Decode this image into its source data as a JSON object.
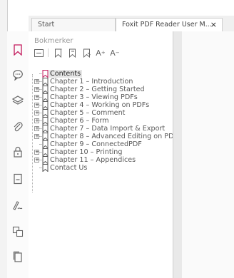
{
  "tabs": [
    {
      "label": "Start"
    },
    {
      "label": "Foxit PDF Reader User M...",
      "close": "×"
    }
  ],
  "panel": {
    "title": "Bokmerker",
    "toolbar": {
      "font_up": "A",
      "font_down": "A"
    }
  },
  "bookmarks": [
    {
      "label": "Contents",
      "expandable": false,
      "selected": true
    },
    {
      "label": "Chapter 1 – Introduction",
      "expandable": true
    },
    {
      "label": "Chapter 2 – Getting Started",
      "expandable": true
    },
    {
      "label": "Chapter 3 – Viewing PDFs",
      "expandable": true
    },
    {
      "label": "Chapter 4 – Working on PDFs",
      "expandable": true
    },
    {
      "label": "Chapter 5 – Comment",
      "expandable": true
    },
    {
      "label": "Chapter 6 – Form",
      "expandable": true
    },
    {
      "label": "Chapter 7 – Data Import & Export",
      "expandable": true
    },
    {
      "label": "Chapter 8 – Advanced Editing on PD",
      "expandable": true
    },
    {
      "label": "Chapter 9 – ConnectedPDF",
      "expandable": false
    },
    {
      "label": "Chapter 10 – Printing",
      "expandable": true
    },
    {
      "label": "Chapter 11 – Appendices",
      "expandable": true
    },
    {
      "label": "Contact Us",
      "expandable": false
    }
  ],
  "colors": {
    "accent": "#c2185b",
    "bookmark_active": "#c2185b",
    "bookmark": "#555555"
  },
  "sidebar_icons": [
    "bookmark-icon",
    "comment-icon",
    "layers-icon",
    "attachment-icon",
    "lock-icon",
    "page-icon",
    "signature-icon",
    "content-icon",
    "pages-icon"
  ]
}
